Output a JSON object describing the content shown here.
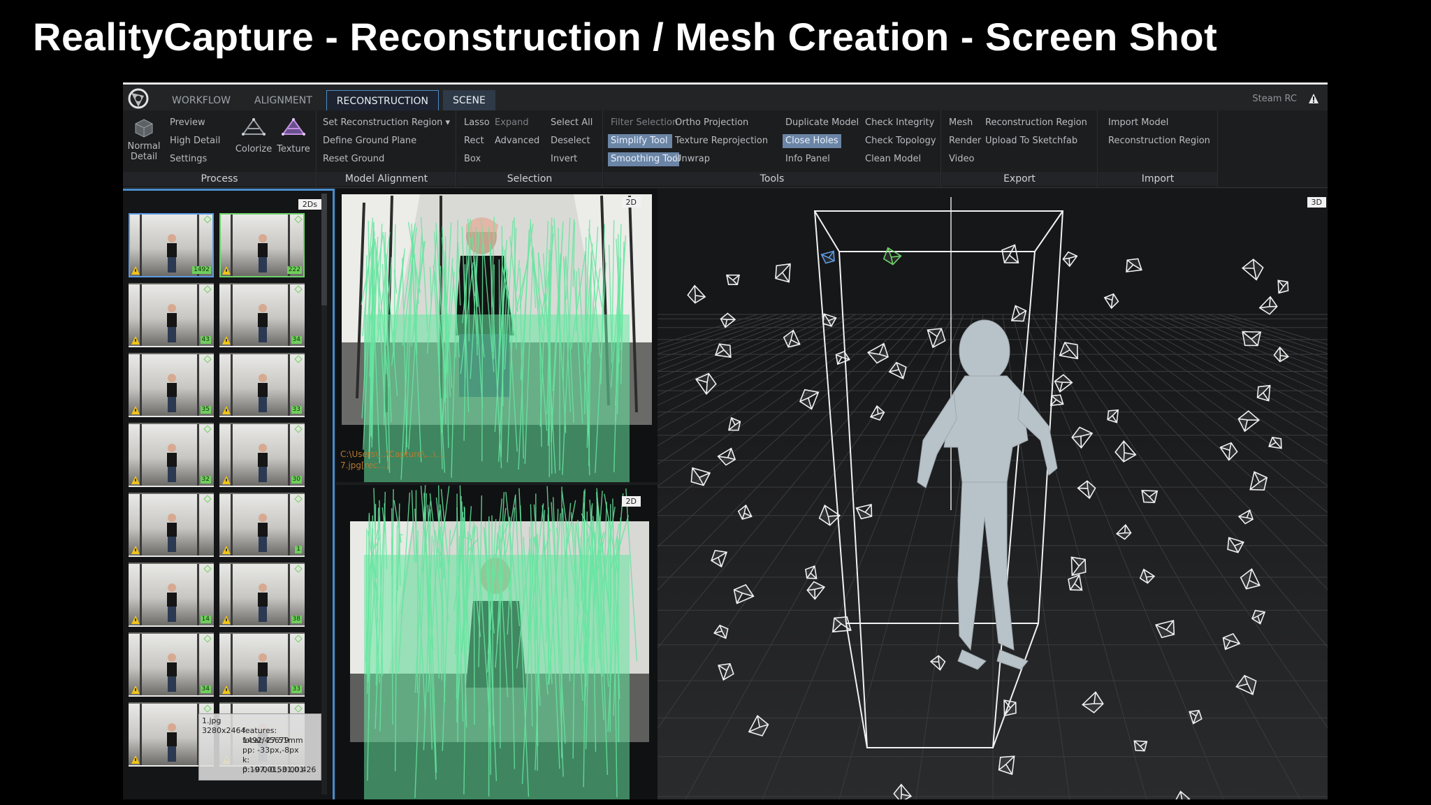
{
  "slide": {
    "title": "RealityCapture - Reconstruction / Mesh Creation - Screen Shot"
  },
  "topbar": {
    "tabs": [
      {
        "label": "WORKFLOW",
        "state": "normal"
      },
      {
        "label": "ALIGNMENT",
        "state": "normal"
      },
      {
        "label": "RECONSTRUCTION",
        "state": "active"
      },
      {
        "label": "SCENE",
        "state": "highlight"
      }
    ],
    "app_name": "Steam RC",
    "warning_icon": "warning-icon"
  },
  "ribbon": {
    "process": {
      "label": "Process",
      "normal_detail_line1": "Normal",
      "normal_detail_line2": "Detail",
      "items": [
        "Preview",
        "High Detail",
        "Settings"
      ],
      "colorize": "Colorize",
      "texture": "Texture"
    },
    "model_alignment": {
      "label": "Model Alignment",
      "items": [
        "Set Reconstruction Region",
        "Define Ground Plane",
        "Reset Ground"
      ]
    },
    "selection": {
      "label": "Selection",
      "col1": [
        "Lasso",
        "Rect",
        "Box"
      ],
      "col2": [
        "Expand",
        "Advanced"
      ],
      "col3": [
        "Select All",
        "Deselect",
        "Invert"
      ]
    },
    "tools": {
      "label": "Tools",
      "col1": [
        "Filter Selection",
        "Simplify Tool",
        "Smoothing Tool"
      ],
      "col2": [
        "Ortho Projection",
        "Texture Reprojection",
        "Unwrap"
      ],
      "col3": [
        "Duplicate Model",
        "Close Holes",
        "Info Panel"
      ],
      "col4": [
        "Check Integrity",
        "Check Topology",
        "Clean Model"
      ]
    },
    "export": {
      "label": "Export",
      "col1": [
        "Mesh",
        "Render",
        "Video"
      ],
      "col2": [
        "Reconstruction Region",
        "Upload To Sketchfab"
      ]
    },
    "import": {
      "label": "Import",
      "items": [
        "Import Model",
        "Reconstruction Region"
      ]
    }
  },
  "panels": {
    "images_tag": "2Ds",
    "view2d_top_tag": "2D",
    "view2d_bottom_tag": "2D",
    "view3d_tag": "3D",
    "path_line1": "C:\\Users\\...\\Capture\\...\\...",
    "path_line2": "7.jpg[rec...]"
  },
  "thumbnails": [
    {
      "count": "1492",
      "sel": "blue"
    },
    {
      "count": "222",
      "sel": "green"
    },
    {
      "count": "43",
      "sel": ""
    },
    {
      "count": "34",
      "sel": ""
    },
    {
      "count": "35",
      "sel": ""
    },
    {
      "count": "33",
      "sel": ""
    },
    {
      "count": "32",
      "sel": ""
    },
    {
      "count": "30",
      "sel": ""
    },
    {
      "count": "",
      "sel": ""
    },
    {
      "count": "1",
      "sel": ""
    },
    {
      "count": "14",
      "sel": ""
    },
    {
      "count": "38",
      "sel": ""
    },
    {
      "count": "34",
      "sel": ""
    },
    {
      "count": "33",
      "sel": ""
    },
    {
      "count": "",
      "sel": ""
    },
    {
      "count": "",
      "sel": ""
    }
  ],
  "tooltip": {
    "filename": "1.jpg",
    "size": "3280x2464",
    "features": "features: 1492/45679",
    "focal": "focal: 27.51mm",
    "pp": "pp: -33px,-8px",
    "k": "k: 0.197,-0.531,0.426",
    "p": "p: -0.001,-0.001"
  },
  "colors": {
    "accent_blue": "#4a8cc9",
    "match_green": "#66e6a0",
    "mesh_grey": "#b8c2c9",
    "selected_button": "#6b85a6"
  }
}
